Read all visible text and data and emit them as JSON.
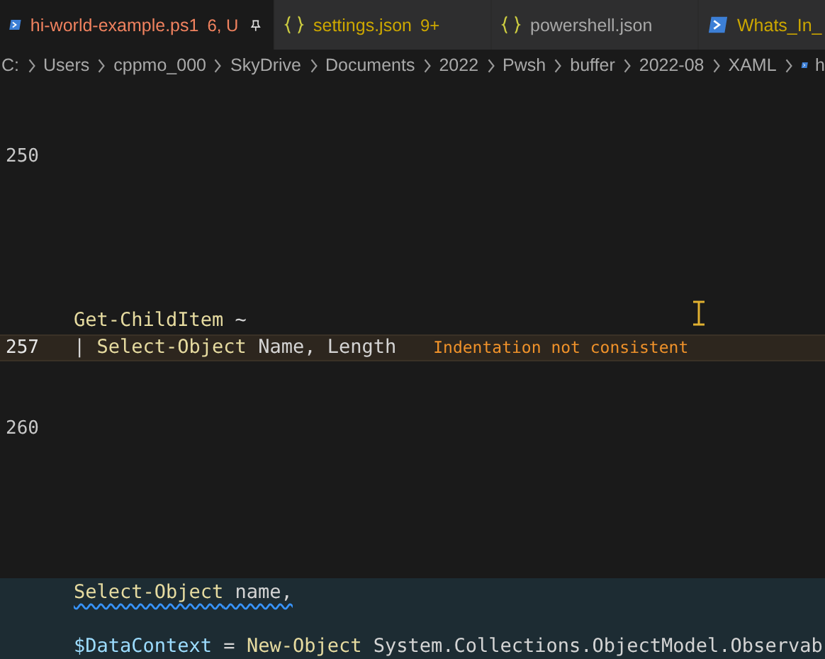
{
  "tabs": [
    {
      "kind": "powershell",
      "label": "hi-world-example.ps1",
      "badge": "6, U",
      "color": "#f0825f",
      "selected": true,
      "pinned": true
    },
    {
      "kind": "json",
      "label": "settings.json",
      "badge": "9+",
      "color": "#cca700",
      "selected": false
    },
    {
      "kind": "json",
      "label": "powershell.json",
      "color": "#a8a8a8",
      "selected": false
    },
    {
      "kind": "powershell",
      "label": "Whats_In_",
      "color": "#cca700",
      "selected": false
    }
  ],
  "breadcrumb": [
    {
      "kind": "folder",
      "label": "C:"
    },
    {
      "kind": "folder",
      "label": "Users"
    },
    {
      "kind": "folder",
      "label": "cppmo_000"
    },
    {
      "kind": "folder",
      "label": "SkyDrive"
    },
    {
      "kind": "folder",
      "label": "Documents"
    },
    {
      "kind": "folder",
      "label": "2022"
    },
    {
      "kind": "folder",
      "label": "Pwsh"
    },
    {
      "kind": "folder",
      "label": "buffer"
    },
    {
      "kind": "folder",
      "label": "2022-08"
    },
    {
      "kind": "folder",
      "label": "XAML"
    },
    {
      "kind": "powershell",
      "label": "h"
    }
  ],
  "lines": [
    {
      "kind": "blank"
    },
    {
      "kind": "blank"
    },
    {
      "kind": "code",
      "number": "250"
    },
    {
      "kind": "blank"
    },
    {
      "kind": "blank"
    },
    {
      "kind": "blank"
    },
    {
      "kind": "blank"
    },
    {
      "kind": "blank"
    },
    {
      "kind": "code",
      "tokens": [
        {
          "kind": "command",
          "text": "Get-ChildItem"
        },
        {
          "kind": "plain",
          "text": " ~"
        }
      ]
    },
    {
      "kind": "code",
      "number": "257",
      "current": true,
      "tokens": [
        {
          "kind": "plain",
          "text": "| "
        },
        {
          "kind": "command",
          "text": "Select-Object"
        },
        {
          "kind": "plain",
          "text": " Name, Length"
        }
      ],
      "hint": "Indentation not consistent"
    },
    {
      "kind": "blank"
    },
    {
      "kind": "blank"
    },
    {
      "kind": "code",
      "number": "260"
    },
    {
      "kind": "blank"
    },
    {
      "kind": "blank"
    },
    {
      "kind": "blank"
    },
    {
      "kind": "blank"
    },
    {
      "kind": "blank"
    },
    {
      "kind": "code",
      "highlighted": true,
      "squiggle": true,
      "tokens": [
        {
          "kind": "command",
          "text": "Select-Object"
        },
        {
          "kind": "plain",
          "text": " name,"
        }
      ]
    },
    {
      "kind": "code",
      "highlighted": true
    },
    {
      "kind": "code",
      "highlighted": true,
      "tokens": [
        {
          "kind": "variable",
          "text": "$DataContext"
        },
        {
          "kind": "plain",
          "text": " = "
        },
        {
          "kind": "command",
          "text": "New-Object"
        },
        {
          "kind": "plain",
          "text": " System.Collections.ObjectModel.Observab"
        }
      ]
    }
  ]
}
